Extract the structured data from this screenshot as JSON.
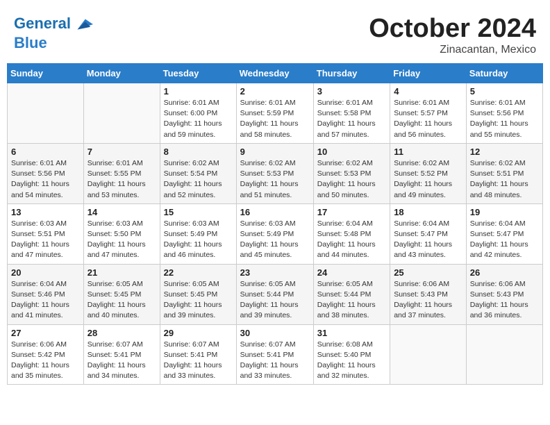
{
  "header": {
    "logo_line1": "General",
    "logo_line2": "Blue",
    "month": "October 2024",
    "location": "Zinacantan, Mexico"
  },
  "weekdays": [
    "Sunday",
    "Monday",
    "Tuesday",
    "Wednesday",
    "Thursday",
    "Friday",
    "Saturday"
  ],
  "weeks": [
    [
      {
        "day": "",
        "info": ""
      },
      {
        "day": "",
        "info": ""
      },
      {
        "day": "1",
        "info": "Sunrise: 6:01 AM\nSunset: 6:00 PM\nDaylight: 11 hours and 59 minutes."
      },
      {
        "day": "2",
        "info": "Sunrise: 6:01 AM\nSunset: 5:59 PM\nDaylight: 11 hours and 58 minutes."
      },
      {
        "day": "3",
        "info": "Sunrise: 6:01 AM\nSunset: 5:58 PM\nDaylight: 11 hours and 57 minutes."
      },
      {
        "day": "4",
        "info": "Sunrise: 6:01 AM\nSunset: 5:57 PM\nDaylight: 11 hours and 56 minutes."
      },
      {
        "day": "5",
        "info": "Sunrise: 6:01 AM\nSunset: 5:56 PM\nDaylight: 11 hours and 55 minutes."
      }
    ],
    [
      {
        "day": "6",
        "info": "Sunrise: 6:01 AM\nSunset: 5:56 PM\nDaylight: 11 hours and 54 minutes."
      },
      {
        "day": "7",
        "info": "Sunrise: 6:01 AM\nSunset: 5:55 PM\nDaylight: 11 hours and 53 minutes."
      },
      {
        "day": "8",
        "info": "Sunrise: 6:02 AM\nSunset: 5:54 PM\nDaylight: 11 hours and 52 minutes."
      },
      {
        "day": "9",
        "info": "Sunrise: 6:02 AM\nSunset: 5:53 PM\nDaylight: 11 hours and 51 minutes."
      },
      {
        "day": "10",
        "info": "Sunrise: 6:02 AM\nSunset: 5:53 PM\nDaylight: 11 hours and 50 minutes."
      },
      {
        "day": "11",
        "info": "Sunrise: 6:02 AM\nSunset: 5:52 PM\nDaylight: 11 hours and 49 minutes."
      },
      {
        "day": "12",
        "info": "Sunrise: 6:02 AM\nSunset: 5:51 PM\nDaylight: 11 hours and 48 minutes."
      }
    ],
    [
      {
        "day": "13",
        "info": "Sunrise: 6:03 AM\nSunset: 5:51 PM\nDaylight: 11 hours and 47 minutes."
      },
      {
        "day": "14",
        "info": "Sunrise: 6:03 AM\nSunset: 5:50 PM\nDaylight: 11 hours and 47 minutes."
      },
      {
        "day": "15",
        "info": "Sunrise: 6:03 AM\nSunset: 5:49 PM\nDaylight: 11 hours and 46 minutes."
      },
      {
        "day": "16",
        "info": "Sunrise: 6:03 AM\nSunset: 5:49 PM\nDaylight: 11 hours and 45 minutes."
      },
      {
        "day": "17",
        "info": "Sunrise: 6:04 AM\nSunset: 5:48 PM\nDaylight: 11 hours and 44 minutes."
      },
      {
        "day": "18",
        "info": "Sunrise: 6:04 AM\nSunset: 5:47 PM\nDaylight: 11 hours and 43 minutes."
      },
      {
        "day": "19",
        "info": "Sunrise: 6:04 AM\nSunset: 5:47 PM\nDaylight: 11 hours and 42 minutes."
      }
    ],
    [
      {
        "day": "20",
        "info": "Sunrise: 6:04 AM\nSunset: 5:46 PM\nDaylight: 11 hours and 41 minutes."
      },
      {
        "day": "21",
        "info": "Sunrise: 6:05 AM\nSunset: 5:45 PM\nDaylight: 11 hours and 40 minutes."
      },
      {
        "day": "22",
        "info": "Sunrise: 6:05 AM\nSunset: 5:45 PM\nDaylight: 11 hours and 39 minutes."
      },
      {
        "day": "23",
        "info": "Sunrise: 6:05 AM\nSunset: 5:44 PM\nDaylight: 11 hours and 39 minutes."
      },
      {
        "day": "24",
        "info": "Sunrise: 6:05 AM\nSunset: 5:44 PM\nDaylight: 11 hours and 38 minutes."
      },
      {
        "day": "25",
        "info": "Sunrise: 6:06 AM\nSunset: 5:43 PM\nDaylight: 11 hours and 37 minutes."
      },
      {
        "day": "26",
        "info": "Sunrise: 6:06 AM\nSunset: 5:43 PM\nDaylight: 11 hours and 36 minutes."
      }
    ],
    [
      {
        "day": "27",
        "info": "Sunrise: 6:06 AM\nSunset: 5:42 PM\nDaylight: 11 hours and 35 minutes."
      },
      {
        "day": "28",
        "info": "Sunrise: 6:07 AM\nSunset: 5:41 PM\nDaylight: 11 hours and 34 minutes."
      },
      {
        "day": "29",
        "info": "Sunrise: 6:07 AM\nSunset: 5:41 PM\nDaylight: 11 hours and 33 minutes."
      },
      {
        "day": "30",
        "info": "Sunrise: 6:07 AM\nSunset: 5:41 PM\nDaylight: 11 hours and 33 minutes."
      },
      {
        "day": "31",
        "info": "Sunrise: 6:08 AM\nSunset: 5:40 PM\nDaylight: 11 hours and 32 minutes."
      },
      {
        "day": "",
        "info": ""
      },
      {
        "day": "",
        "info": ""
      }
    ]
  ]
}
